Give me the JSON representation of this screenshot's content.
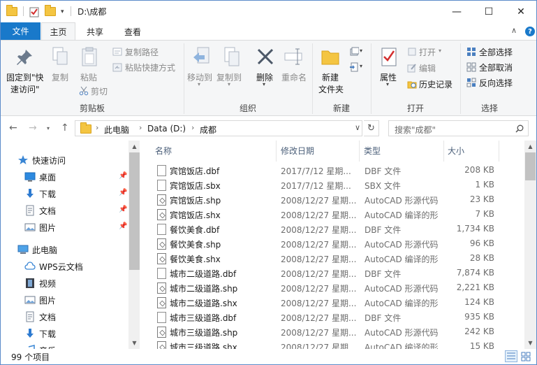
{
  "window": {
    "title": "D:\\成都",
    "minimize": "—",
    "maximize": "☐",
    "close": "✕"
  },
  "ribbon_tabs": {
    "file": "文件",
    "home": "主页",
    "share": "共享",
    "view": "查看",
    "collapse": "∧",
    "help": "?"
  },
  "ribbon": {
    "clipboard": {
      "pin_quick_access_line1": "固定到\"快",
      "pin_quick_access_line2": "速访问\"",
      "copy": "复制",
      "paste": "粘贴",
      "copy_path": "复制路径",
      "paste_shortcut": "粘贴快捷方式",
      "cut": "剪切",
      "label": "剪贴板"
    },
    "organize": {
      "move_to": "移动到",
      "copy_to": "复制到",
      "delete": "删除",
      "rename": "重命名",
      "label": "组织"
    },
    "new": {
      "new_folder_line1": "新建",
      "new_folder_line2": "文件夹",
      "label": "新建"
    },
    "open": {
      "properties": "属性",
      "open": "打开",
      "edit": "编辑",
      "history": "历史记录",
      "label": "打开"
    },
    "select": {
      "select_all": "全部选择",
      "select_none": "全部取消",
      "invert": "反向选择",
      "label": "选择"
    }
  },
  "address": {
    "crumbs": [
      "此电脑",
      "Data (D:)",
      "成都"
    ],
    "search_placeholder": "搜索\"成都\""
  },
  "nav_pane": {
    "items": [
      {
        "label": "快速访问",
        "icon": "star-icon",
        "pinned": false
      },
      {
        "label": "桌面",
        "icon": "desktop-icon",
        "pinned": true
      },
      {
        "label": "下载",
        "icon": "download-icon",
        "pinned": true
      },
      {
        "label": "文档",
        "icon": "document-icon",
        "pinned": true
      },
      {
        "label": "图片",
        "icon": "picture-icon",
        "pinned": true
      },
      {
        "label": "此电脑",
        "icon": "computer-icon",
        "pinned": false
      },
      {
        "label": "WPS云文档",
        "icon": "cloud-icon",
        "pinned": false
      },
      {
        "label": "视频",
        "icon": "video-icon",
        "pinned": false
      },
      {
        "label": "图片",
        "icon": "picture-icon",
        "pinned": false
      },
      {
        "label": "文档",
        "icon": "document-icon",
        "pinned": false
      },
      {
        "label": "下载",
        "icon": "download-icon",
        "pinned": false
      },
      {
        "label": "音乐",
        "icon": "music-icon",
        "pinned": false
      }
    ]
  },
  "columns": {
    "name": "名称",
    "date": "修改日期",
    "type": "类型",
    "size": "大小"
  },
  "files": [
    {
      "name": "宾馆饭店.dbf",
      "date": "2017/7/12 星期...",
      "type": "DBF 文件",
      "size": "208 KB",
      "cad": false
    },
    {
      "name": "宾馆饭店.sbx",
      "date": "2017/7/12 星期...",
      "type": "SBX 文件",
      "size": "1 KB",
      "cad": false
    },
    {
      "name": "宾馆饭店.shp",
      "date": "2008/12/27 星期...",
      "type": "AutoCAD 形源代码",
      "size": "23 KB",
      "cad": true
    },
    {
      "name": "宾馆饭店.shx",
      "date": "2008/12/27 星期...",
      "type": "AutoCAD 编译的形",
      "size": "7 KB",
      "cad": true
    },
    {
      "name": "餐饮美食.dbf",
      "date": "2008/12/27 星期...",
      "type": "DBF 文件",
      "size": "1,734 KB",
      "cad": false
    },
    {
      "name": "餐饮美食.shp",
      "date": "2008/12/27 星期...",
      "type": "AutoCAD 形源代码",
      "size": "96 KB",
      "cad": true
    },
    {
      "name": "餐饮美食.shx",
      "date": "2008/12/27 星期...",
      "type": "AutoCAD 编译的形",
      "size": "28 KB",
      "cad": true
    },
    {
      "name": "城市二级道路.dbf",
      "date": "2008/12/27 星期...",
      "type": "DBF 文件",
      "size": "7,874 KB",
      "cad": false
    },
    {
      "name": "城市二级道路.shp",
      "date": "2008/12/27 星期...",
      "type": "AutoCAD 形源代码",
      "size": "2,221 KB",
      "cad": true
    },
    {
      "name": "城市二级道路.shx",
      "date": "2008/12/27 星期...",
      "type": "AutoCAD 编译的形",
      "size": "124 KB",
      "cad": true
    },
    {
      "name": "城市三级道路.dbf",
      "date": "2008/12/27 星期...",
      "type": "DBF 文件",
      "size": "935 KB",
      "cad": false
    },
    {
      "name": "城市三级道路.shp",
      "date": "2008/12/27 星期...",
      "type": "AutoCAD 形源代码",
      "size": "242 KB",
      "cad": true
    },
    {
      "name": "城市三级道路.shx",
      "date": "2008/12/27 星期...",
      "type": "AutoCAD 编译的形",
      "size": "15 KB",
      "cad": true
    }
  ],
  "status": {
    "count": "99 个项目"
  },
  "colors": {
    "accent": "#1979ca",
    "folder": "#f4c542"
  }
}
